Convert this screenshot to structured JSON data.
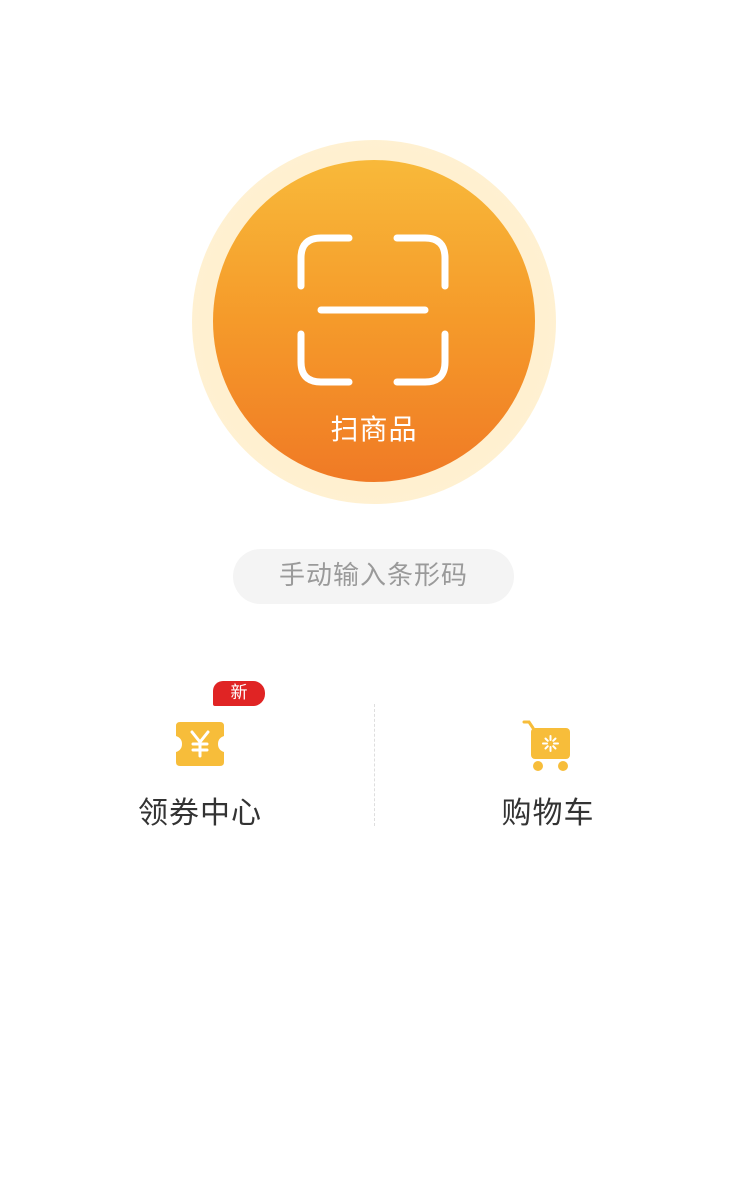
{
  "scan": {
    "label": "扫商品",
    "icon": "scan-frame-icon"
  },
  "manual_input": {
    "label": "手动输入条形码"
  },
  "entries": {
    "coupon": {
      "label": "领券中心",
      "badge": "新",
      "icon": "coupon-ticket-icon"
    },
    "cart": {
      "label": "购物车",
      "icon": "shopping-cart-icon"
    }
  },
  "colors": {
    "scan_gradient_top": "#f8b93a",
    "scan_gradient_bottom": "#f07a25",
    "icon_yellow": "#f7bd3a",
    "badge_red": "#e02424"
  }
}
